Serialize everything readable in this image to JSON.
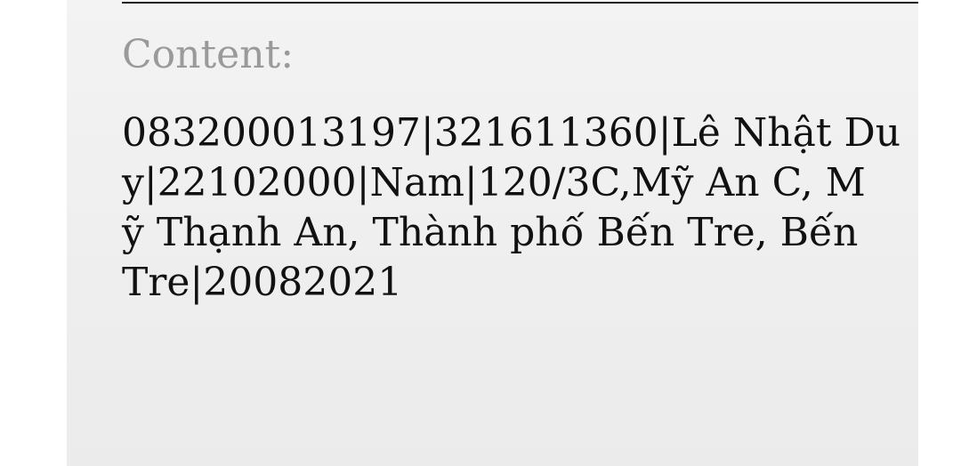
{
  "result": {
    "label": "Content:",
    "lines": [
      "083200013197|321611360|Lê Nhật Du",
      "y|22102000|Nam|120/3C,Mỹ An C, M",
      "ỹ Thạnh An, Thành phố Bến Tre, Bến",
      "Tre|20082021"
    ]
  }
}
